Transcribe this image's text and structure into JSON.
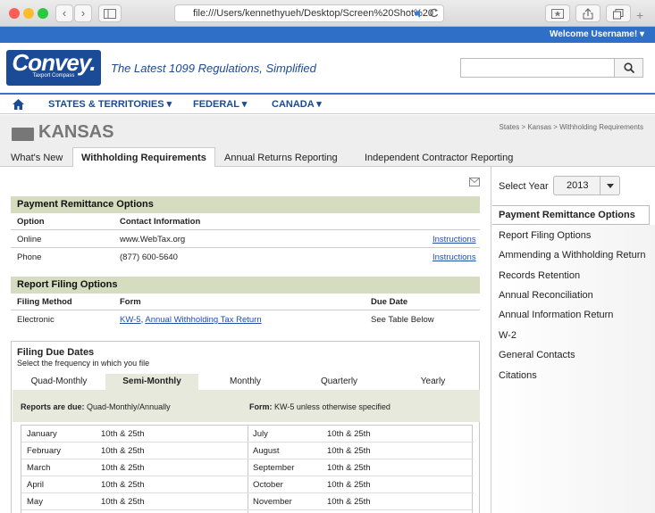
{
  "browser": {
    "url": "file:///Users/kennethyueh/Desktop/Screen%20Shot%20",
    "back": "‹",
    "forward": "›"
  },
  "topbar": {
    "welcome": "Welcome Username! ▾"
  },
  "header": {
    "logo_main": "Convey.",
    "logo_sub": "Taxport Compass",
    "tagline": "The Latest 1099 Regulations, Simplified",
    "search_placeholder": ""
  },
  "nav": {
    "items": [
      "STATES & TERRITORIES ▾",
      "FEDERAL ▾",
      "CANADA ▾"
    ]
  },
  "page": {
    "title": "KANSAS",
    "breadcrumb": [
      "States",
      "Kansas",
      "Withholding Requirements"
    ],
    "tabs": [
      "What's New",
      "Withholding Requirements",
      "Annual Returns Reporting",
      "Independent Contractor Reporting"
    ]
  },
  "payment": {
    "heading": "Payment Remittance Options",
    "headers": [
      "Option",
      "Contact Information"
    ],
    "rows": [
      {
        "option": "Online",
        "contact": "www.WebTax.org",
        "link": "Instructions"
      },
      {
        "option": "Phone",
        "contact": "(877) 600-5640",
        "link": "Instructions"
      }
    ]
  },
  "filing": {
    "heading": "Report Filing Options",
    "headers": [
      "Filing Method",
      "Form",
      "Due Date"
    ],
    "row": {
      "method": "Electronic",
      "form_code": "KW-5",
      "form_sep": ", ",
      "form_name": "Annual Withholding Tax Return",
      "due": "See Table Below"
    }
  },
  "due_dates": {
    "heading": "Filing Due Dates",
    "subheading": "Select the frequency in which you file",
    "tabs": [
      "Quad-Monthly",
      "Semi-Monthly",
      "Monthly",
      "Quarterly",
      "Yearly"
    ],
    "reports_label": "Reports are due:",
    "reports_value": " Quad-Monthly/Annually",
    "form_label": "Form:",
    "form_value": " KW-5 unless otherwise specified",
    "left": [
      {
        "month": "January",
        "days": "10th & 25th"
      },
      {
        "month": "February",
        "days": "10th & 25th"
      },
      {
        "month": "March",
        "days": "10th & 25th"
      },
      {
        "month": "April",
        "days": "10th & 25th"
      },
      {
        "month": "May",
        "days": "10th & 25th"
      }
    ],
    "right": [
      {
        "month": "July",
        "days": "10th & 25th"
      },
      {
        "month": "August",
        "days": "10th & 25th"
      },
      {
        "month": "September",
        "days": "10th & 25th"
      },
      {
        "month": "October",
        "days": "10th & 25th"
      },
      {
        "month": "November",
        "days": "10th & 25th"
      }
    ]
  },
  "sidebar": {
    "year_label": "Select Year",
    "year": "2013",
    "items": [
      "Payment Remittance Options",
      "Report Filing Options",
      "Ammending a Withholding Return",
      "Records Retention",
      "Annual Reconciliation",
      "Annual Information Return",
      "W-2",
      "General Contacts",
      "Citations"
    ]
  },
  "colors": {
    "brand": "#1b4a96",
    "accent": "#2f6fc8",
    "section": "#d6dcc0"
  }
}
